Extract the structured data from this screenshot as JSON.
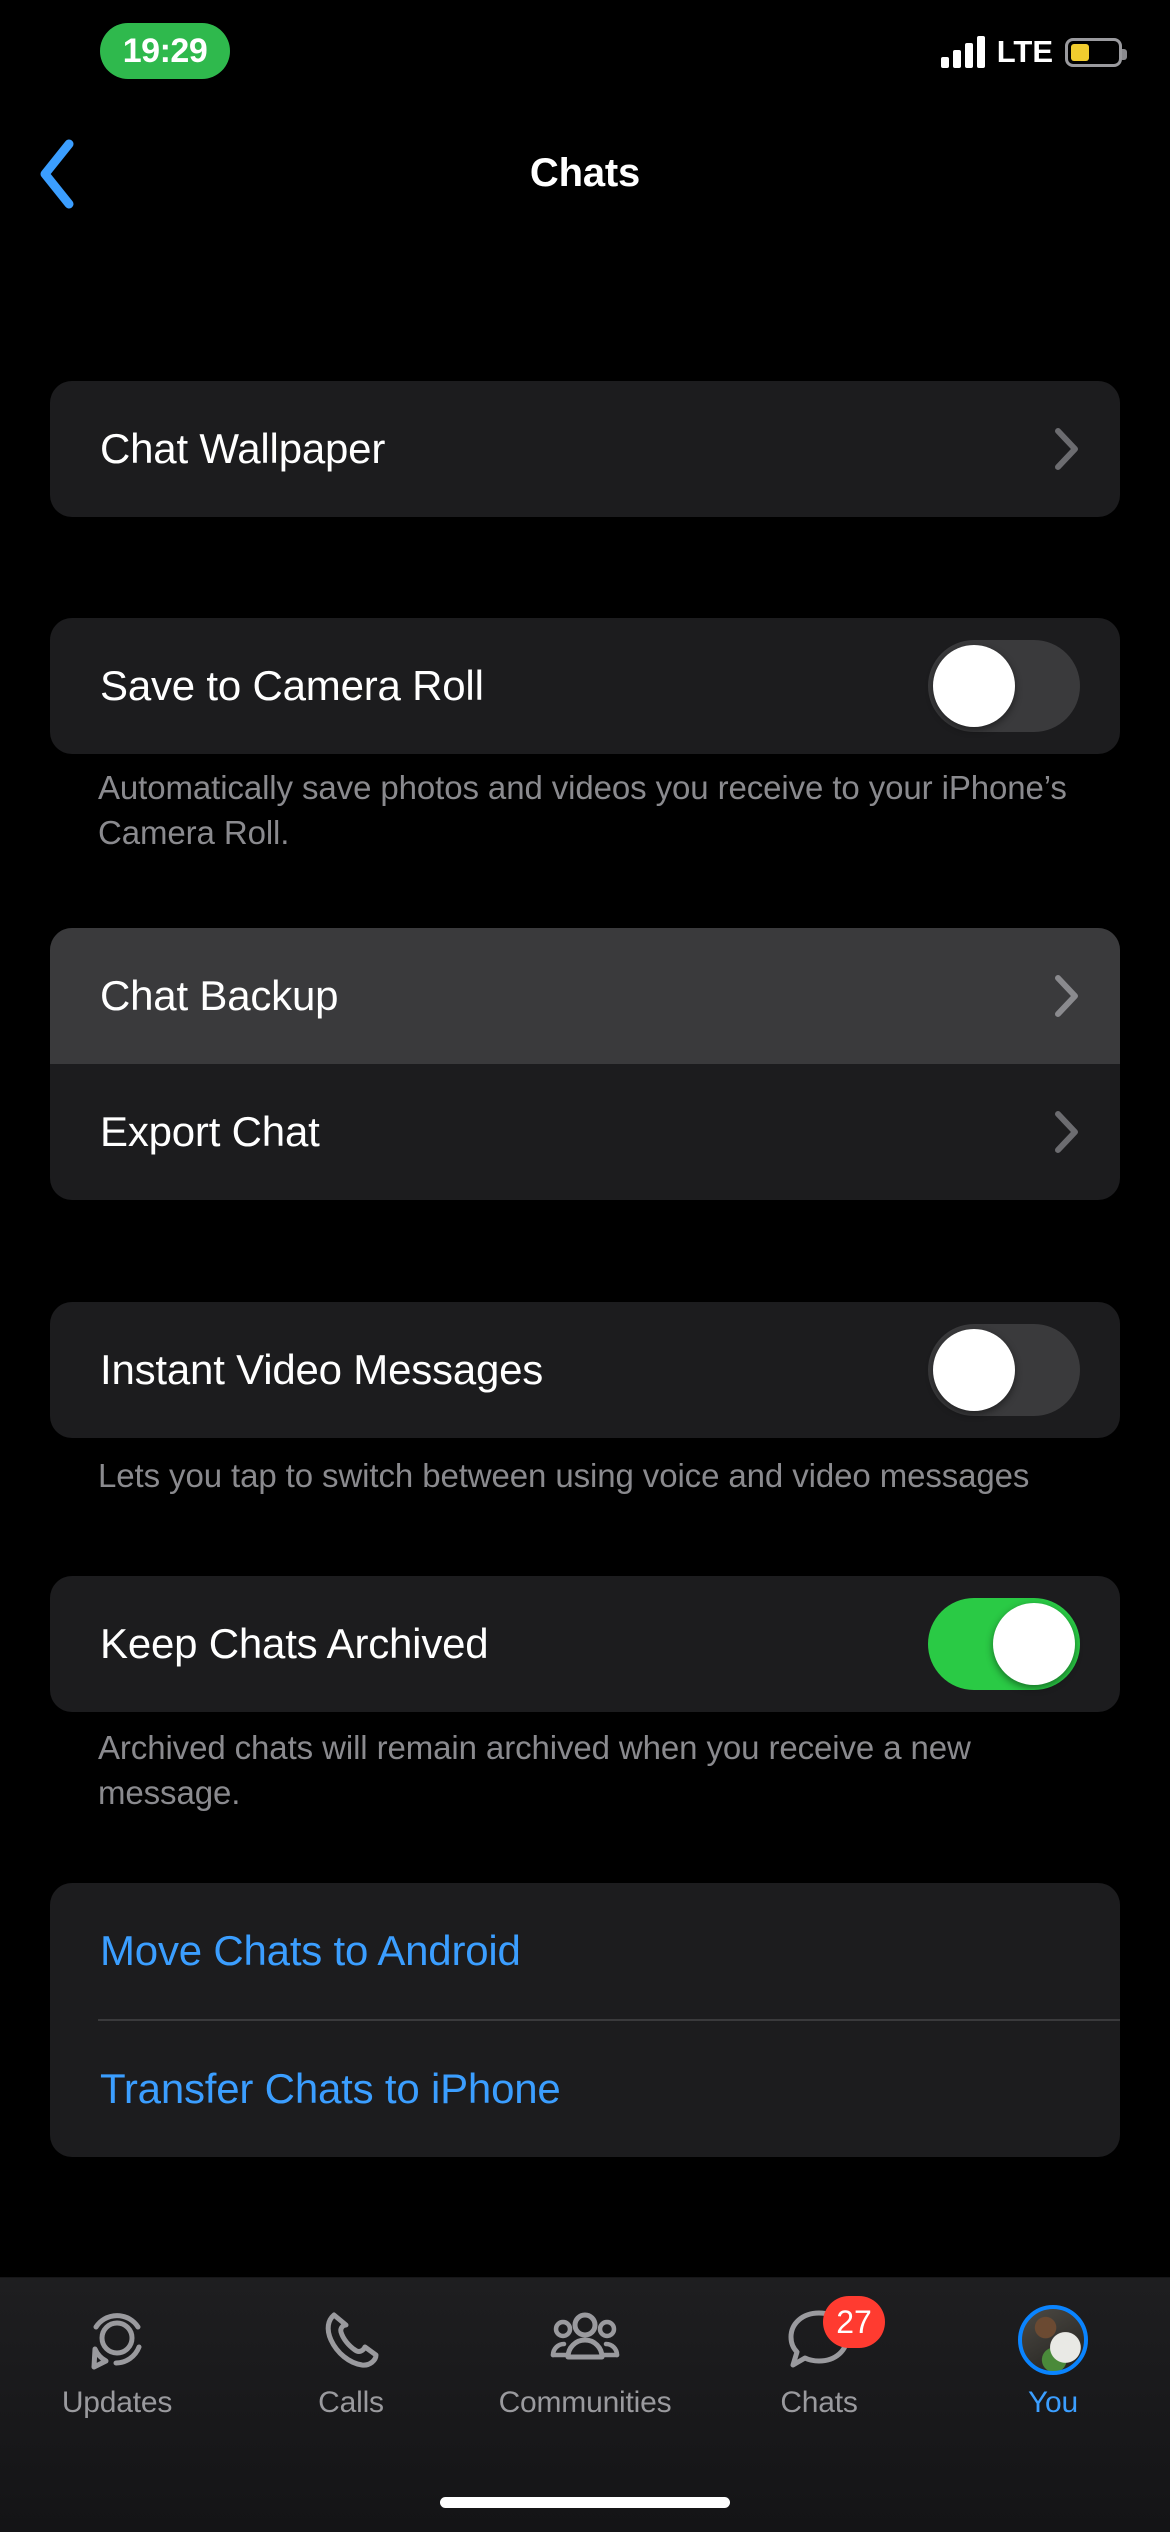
{
  "status_bar": {
    "time": "19:29",
    "time_pill_color": "#2FB94D",
    "carrier": "LTE",
    "signal_icon": "signal-bars-icon",
    "battery_icon": "battery-low-power-icon",
    "battery_color": "#F2CD2E",
    "battery_level_percent": 40
  },
  "nav": {
    "back_icon": "chevron-left-icon",
    "back_color": "#3B9EFF",
    "title": "Chats"
  },
  "sections": [
    {
      "id": "wallpaper",
      "rows": [
        {
          "id": "chat-wallpaper",
          "label": "Chat Wallpaper",
          "accessory": "chevron-right-icon",
          "pressed": false
        }
      ],
      "footnote": ""
    },
    {
      "id": "camera-roll",
      "rows": [
        {
          "id": "save-to-camera-roll",
          "label": "Save to Camera Roll",
          "accessory": "toggle",
          "toggle_on": false
        }
      ],
      "footnote": "Automatically save photos and videos you receive to your iPhone’s Camera Roll."
    },
    {
      "id": "backup",
      "rows": [
        {
          "id": "chat-backup",
          "label": "Chat Backup",
          "accessory": "chevron-right-icon",
          "pressed": true
        },
        {
          "id": "export-chat",
          "label": "Export Chat",
          "accessory": "chevron-right-icon",
          "pressed": false
        }
      ],
      "footnote": ""
    },
    {
      "id": "instant-video",
      "rows": [
        {
          "id": "instant-video-messages",
          "label": "Instant Video Messages",
          "accessory": "toggle",
          "toggle_on": false
        }
      ],
      "footnote": "Lets you tap to switch between using voice and video messages"
    },
    {
      "id": "keep-archived",
      "rows": [
        {
          "id": "keep-chats-archived",
          "label": "Keep Chats Archived",
          "accessory": "toggle",
          "toggle_on": true
        }
      ],
      "footnote": "Archived chats will remain archived when you receive a new message."
    },
    {
      "id": "transfer",
      "rows": [
        {
          "id": "move-chats-to-android",
          "label": "Move Chats to Android",
          "accessory": "none",
          "link": true
        },
        {
          "id": "transfer-chats-to-iphone",
          "label": "Transfer Chats to iPhone",
          "accessory": "none",
          "link": true
        }
      ],
      "footnote": ""
    }
  ],
  "colors": {
    "card_background": "#1C1C1E",
    "card_pressed": "#3A3A3C",
    "link_blue": "#3B9EFF",
    "toggle_on_green": "#2ACA45",
    "toggle_off_gray": "#3A3A3C",
    "footnote_gray": "#8A8A8E",
    "badge_red": "#FF3B30"
  },
  "tab_bar": {
    "items": [
      {
        "id": "updates",
        "label": "Updates",
        "icon": "updates-icon",
        "active": false,
        "badge": ""
      },
      {
        "id": "calls",
        "label": "Calls",
        "icon": "phone-icon",
        "active": false,
        "badge": ""
      },
      {
        "id": "communities",
        "label": "Communities",
        "icon": "communities-icon",
        "active": false,
        "badge": ""
      },
      {
        "id": "chats",
        "label": "Chats",
        "icon": "chat-bubble-icon",
        "active": false,
        "badge": "27"
      },
      {
        "id": "you",
        "label": "You",
        "icon": "avatar-icon",
        "active": true,
        "badge": ""
      }
    ]
  }
}
